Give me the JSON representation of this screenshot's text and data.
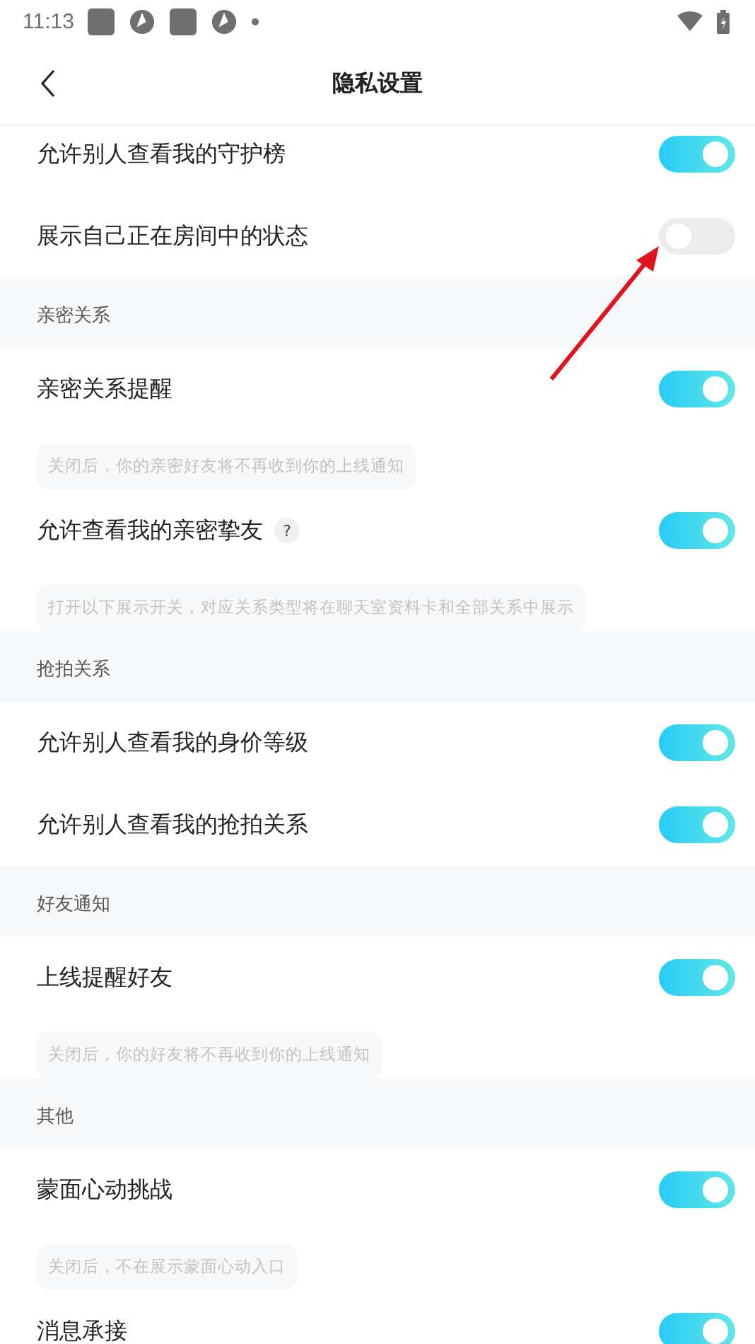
{
  "status_bar": {
    "time": "11:13"
  },
  "header": {
    "title": "隐私设置"
  },
  "sections": [
    {
      "items": [
        {
          "label": "允许别人查看我的守护榜",
          "on": true
        },
        {
          "label": "展示自己正在房间中的状态",
          "on": false
        }
      ]
    },
    {
      "title": "亲密关系",
      "items": [
        {
          "label": "亲密关系提醒",
          "on": true,
          "hint": "关闭后，你的亲密好友将不再收到你的上线通知"
        },
        {
          "label": "允许查看我的亲密挚友",
          "on": true,
          "help": "?",
          "hint": "打开以下展示开关，对应关系类型将在聊天室资料卡和全部关系中展示"
        }
      ]
    },
    {
      "title": "抢拍关系",
      "items": [
        {
          "label": "允许别人查看我的身价等级",
          "on": true
        },
        {
          "label": "允许别人查看我的抢拍关系",
          "on": true
        }
      ]
    },
    {
      "title": "好友通知",
      "items": [
        {
          "label": "上线提醒好友",
          "on": true,
          "hint": "关闭后，你的好友将不再收到你的上线通知"
        }
      ]
    },
    {
      "title": "其他",
      "items": [
        {
          "label": "蒙面心动挑战",
          "on": true,
          "hint": "关闭后，不在展示蒙面心动入口"
        },
        {
          "label": "消息承接",
          "on": true
        }
      ]
    }
  ]
}
